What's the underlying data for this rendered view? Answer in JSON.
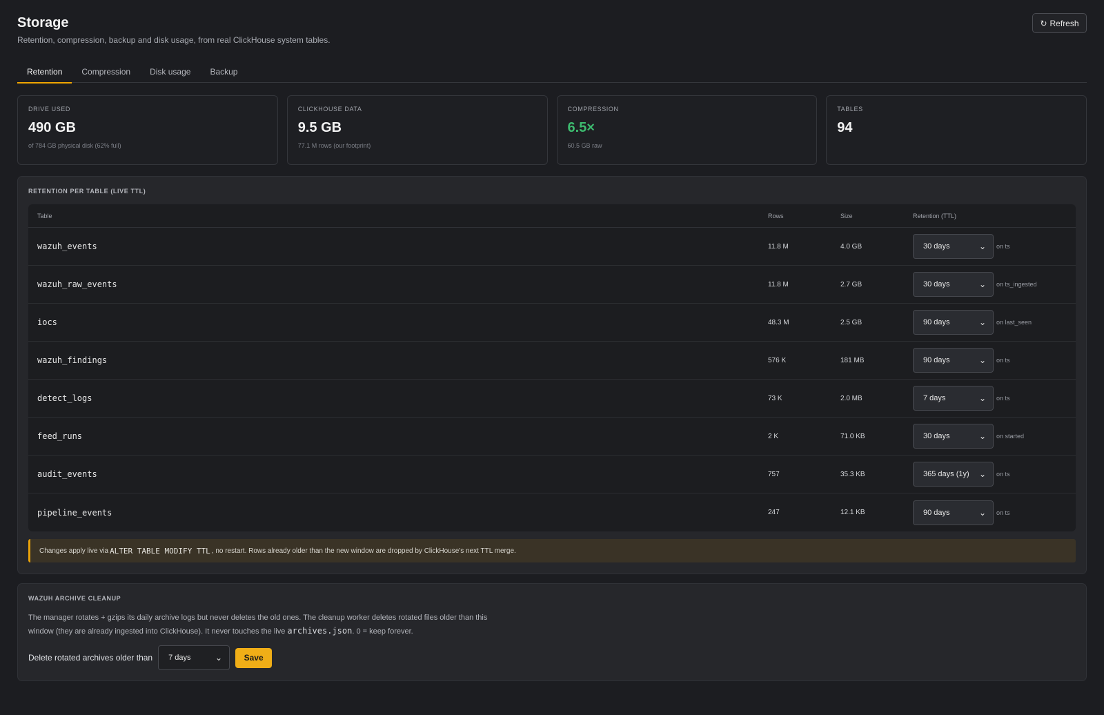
{
  "header": {
    "title": "Storage",
    "subtitle": "Retention, compression, backup and disk usage, from real ClickHouse system tables.",
    "refresh_icon": "↻",
    "refresh_label": "Refresh"
  },
  "tabs": [
    {
      "label": "Retention",
      "active": true
    },
    {
      "label": "Compression",
      "active": false
    },
    {
      "label": "Disk usage",
      "active": false
    },
    {
      "label": "Backup",
      "active": false
    }
  ],
  "stats": [
    {
      "label": "DRIVE USED",
      "value": "490 GB",
      "sub": "of 784 GB physical disk (62% full)"
    },
    {
      "label": "CLICKHOUSE DATA",
      "value": "9.5 GB",
      "sub": "77.1 M rows (our footprint)"
    },
    {
      "label": "COMPRESSION",
      "value": "6.5×",
      "sub": "60.5 GB raw"
    },
    {
      "label": "TABLES",
      "value": "94",
      "sub": ""
    }
  ],
  "retention": {
    "title": "RETENTION PER TABLE (LIVE TTL)",
    "columns": {
      "table": "Table",
      "rows": "Rows",
      "size": "Size",
      "retention": "Retention (TTL)"
    },
    "rows": [
      {
        "name": "wazuh_events",
        "rows": "11.8 M",
        "size": "4.0 GB",
        "ttl": "30 days",
        "on": "on ts"
      },
      {
        "name": "wazuh_raw_events",
        "rows": "11.8 M",
        "size": "2.7 GB",
        "ttl": "30 days",
        "on": "on ts_ingested"
      },
      {
        "name": "iocs",
        "rows": "48.3 M",
        "size": "2.5 GB",
        "ttl": "90 days",
        "on": "on last_seen"
      },
      {
        "name": "wazuh_findings",
        "rows": "576 K",
        "size": "181 MB",
        "ttl": "90 days",
        "on": "on ts"
      },
      {
        "name": "detect_logs",
        "rows": "73 K",
        "size": "2.0 MB",
        "ttl": "7 days",
        "on": "on ts"
      },
      {
        "name": "feed_runs",
        "rows": "2 K",
        "size": "71.0 KB",
        "ttl": "30 days",
        "on": "on started"
      },
      {
        "name": "audit_events",
        "rows": "757",
        "size": "35.3 KB",
        "ttl": "365 days (1y)",
        "on": "on ts"
      },
      {
        "name": "pipeline_events",
        "rows": "247",
        "size": "12.1 KB",
        "ttl": "90 days",
        "on": "on ts"
      }
    ],
    "notice": {
      "before": "Changes apply live via",
      "code": "ALTER TABLE MODIFY TTL",
      "after": ", no restart. Rows already older than the new window are dropped by ClickHouse's next TTL merge."
    }
  },
  "archive": {
    "title": "WAZUH ARCHIVE CLEANUP",
    "desc_before": "The manager rotates + gzips its daily archive logs but never deletes the old ones. The cleanup worker deletes rotated files older than this window (they are already ingested into ClickHouse). It never touches the live",
    "desc_code": "archives.json",
    "desc_after": ". 0 = keep forever.",
    "label": "Delete rotated archives older than",
    "selected": "7 days",
    "save_label": "Save"
  },
  "colors": {
    "accent": "#f0a500",
    "green": "#3dba6f",
    "save": "#f0ae17"
  }
}
